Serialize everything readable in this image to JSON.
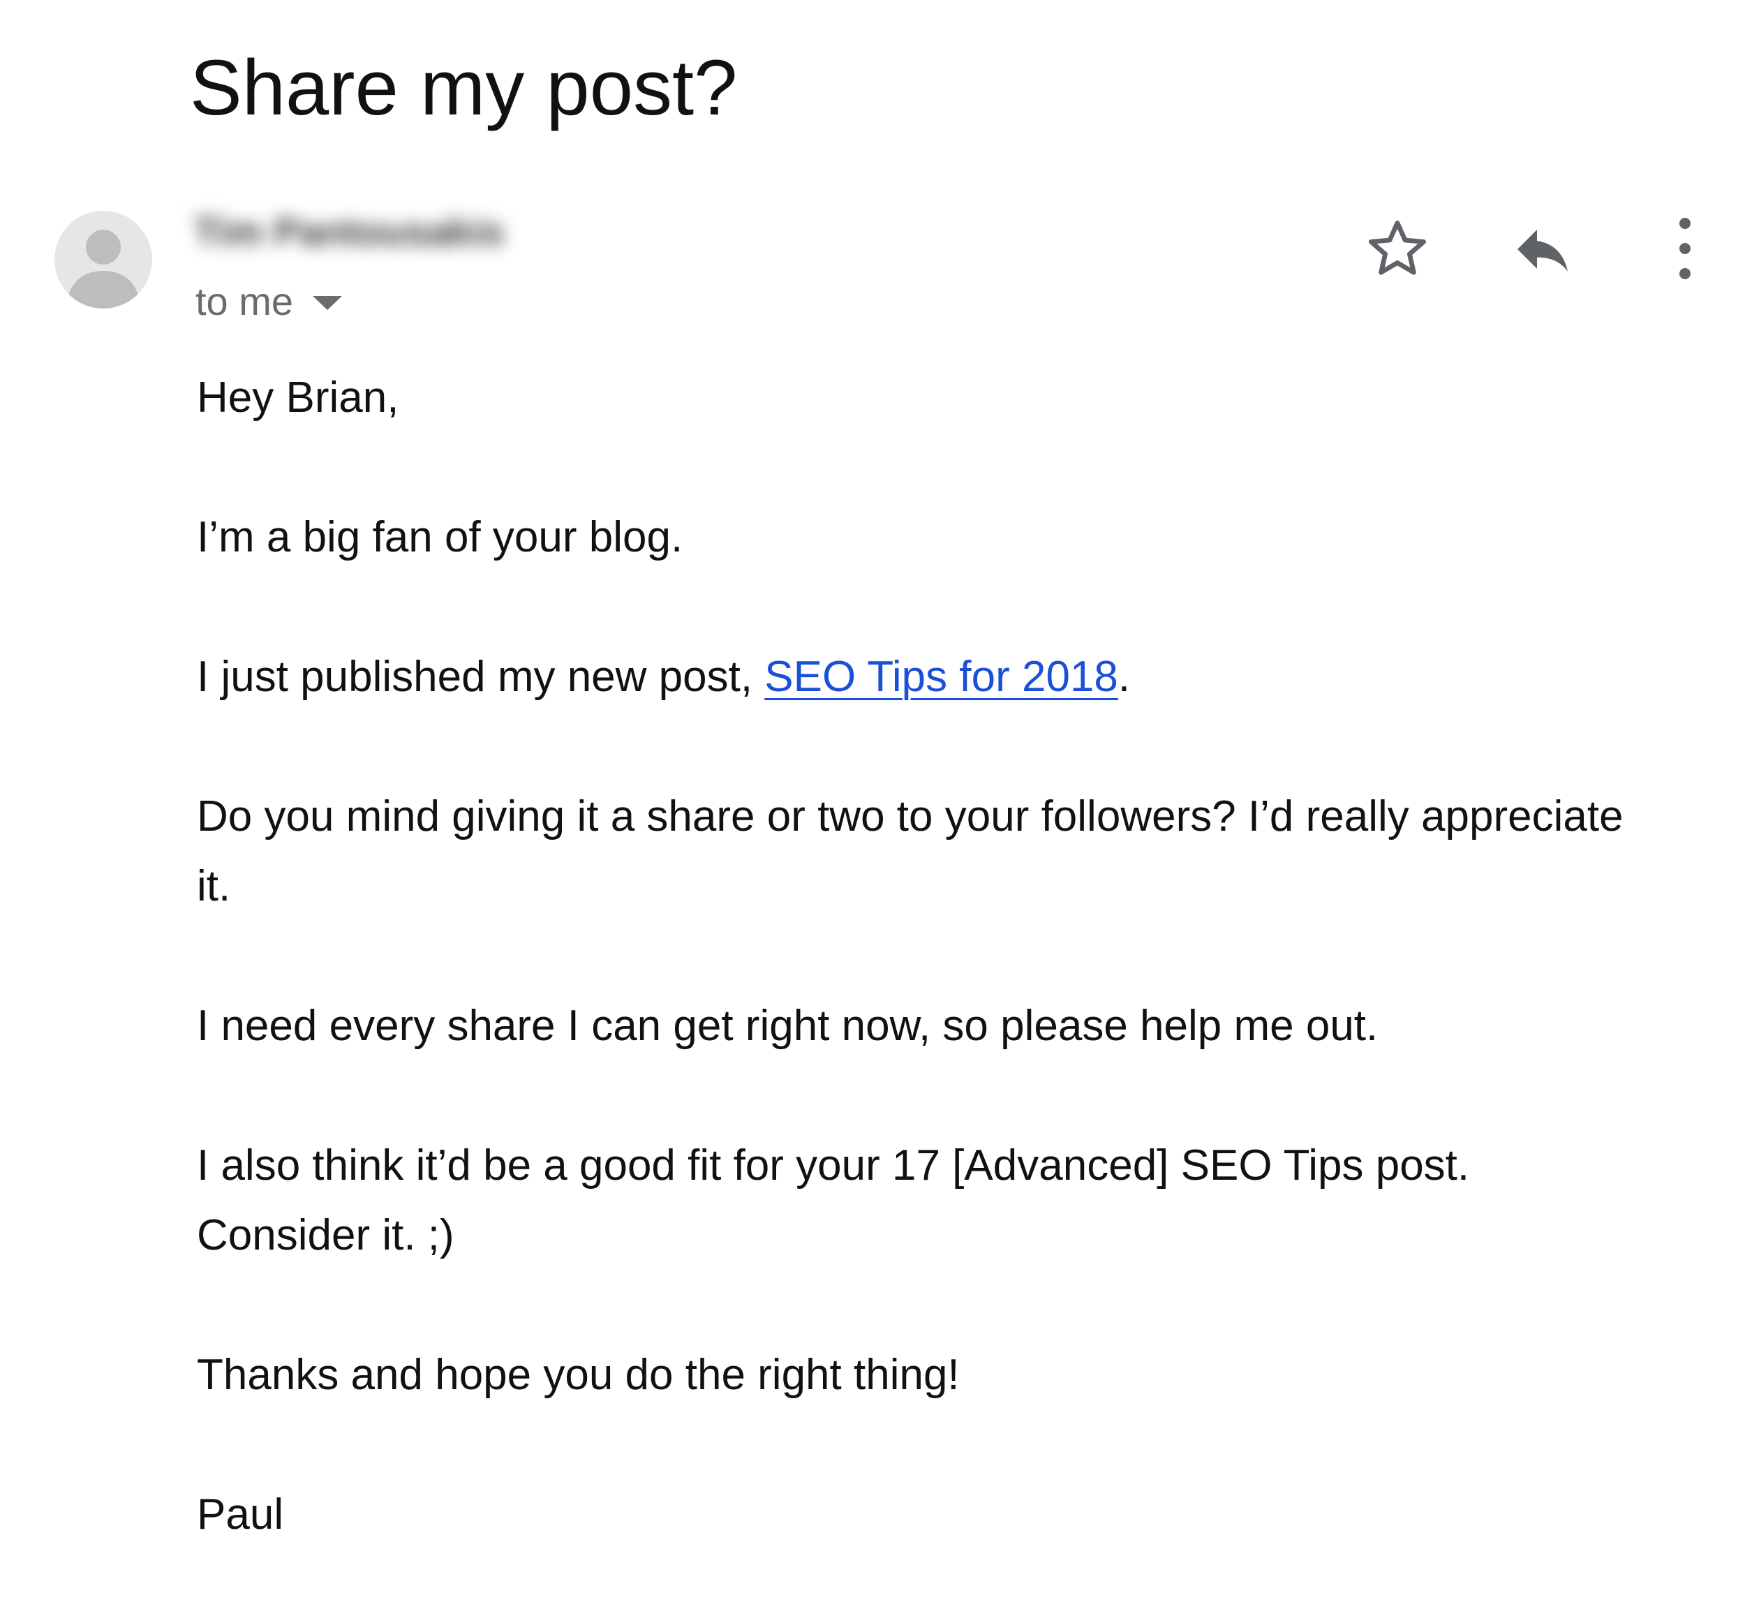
{
  "email": {
    "subject": "Share my post?",
    "sender": {
      "name": "Tim Pantousakis",
      "name_blurred": true,
      "avatar_icon": "person-placeholder-icon"
    },
    "recipient_label": "to me",
    "recipient_caret_icon": "caret-down-icon",
    "actions": {
      "star_icon": "star-outline-icon",
      "reply_icon": "reply-icon",
      "more_icon": "more-vertical-icon"
    },
    "body": {
      "greeting": "Hey Brian,",
      "line_fan": "I’m a big fan of your blog.",
      "line_published_prefix": "I just published my new post, ",
      "post_link_text": "SEO Tips for 2018",
      "line_published_suffix": ".",
      "line_ask": "Do you mind giving it a share or two to your followers? I’d really appreciate it.",
      "line_need": "I need every share I can get right now, so please help me out.",
      "line_fit": "I also think it’d be a good fit for your 17 [Advanced] SEO Tips post. Consider it. ;)",
      "line_thanks": "Thanks and hope you do the right thing!",
      "signature": "Paul"
    }
  },
  "colors": {
    "text": "#111111",
    "secondary_text": "#6b6b6b",
    "icon": "#5f6368",
    "link": "#1a4fd8",
    "avatar_bg": "#e6e6e6",
    "avatar_fg": "#bdbdbd"
  }
}
